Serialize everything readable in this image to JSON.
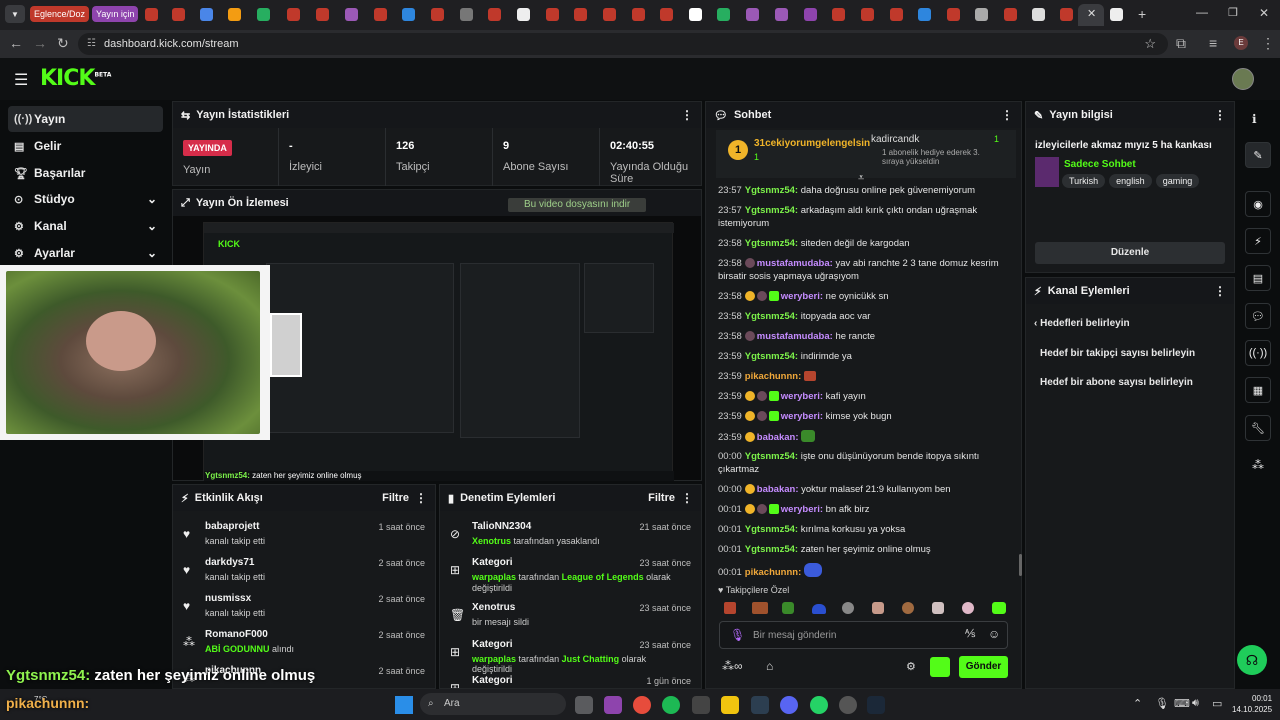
{
  "browser": {
    "pill1": "Eglence/Doz",
    "pill2": "Yayın için",
    "url": "dashboard.kick.com/stream"
  },
  "app": {
    "logo": "KICK",
    "logo_sup": "BETA",
    "brand_color": "#53fc18"
  },
  "sidebar": {
    "items": [
      {
        "label": "Yayın",
        "icon": "stream-icon"
      },
      {
        "label": "Gelir",
        "icon": "revenue-icon"
      },
      {
        "label": "Başarılar",
        "icon": "trophy-icon"
      },
      {
        "label": "Stüdyo",
        "icon": "studio-icon"
      },
      {
        "label": "Kanal",
        "icon": "channel-icon"
      },
      {
        "label": "Ayarlar",
        "icon": "gear-icon"
      }
    ]
  },
  "stats": {
    "title": "Yayın İstatistikleri",
    "live_badge": "YAYINDA",
    "live_label": "Yayın",
    "viewers_value": "-",
    "viewers_label": "İzleyici",
    "followers_value": "126",
    "followers_label": "Takipçi",
    "subs_value": "9",
    "subs_label": "Abone Sayısı",
    "uptime_value": "02:40:55",
    "uptime_label": "Yayında Olduğu Süre"
  },
  "preview": {
    "title": "Yayın Ön İzlemesi",
    "download_hint": "Bu video dosyasını indir",
    "overlay_chat_user": "Ygtsnmz54:",
    "overlay_chat_msg": "zaten her şeyimiz online olmuş",
    "overlay_user2": "pikachunnn:"
  },
  "activity": {
    "title": "Etkinlik Akışı",
    "filter": "Filtre",
    "events": [
      {
        "name": "babaprojett",
        "sub": "kanalı takip etti",
        "time": "1 saat önce"
      },
      {
        "name": "darkdys71",
        "sub": "kanalı takip etti",
        "time": "2 saat önce"
      },
      {
        "name": "nusmissx",
        "sub": "kanalı takip etti",
        "time": "2 saat önce"
      },
      {
        "name": "RomanoF000",
        "sub": "ABİ GODUNNU",
        "sub2": "alındı",
        "time": "2 saat önce"
      },
      {
        "name": "pikachunnn",
        "sub": "",
        "time": "2 saat önce"
      }
    ]
  },
  "moderation": {
    "title": "Denetim Eylemleri",
    "filter": "Filtre",
    "events": [
      {
        "name": "TalioNN2304",
        "g": "Xenotrus",
        "sub": "tarafından yasaklandı",
        "time": "21 saat önce"
      },
      {
        "name": "Kategori",
        "g": "warpaplas",
        "sub": "tarafından",
        "g2": "League of Legends",
        "sub2": "olarak değiştirildi",
        "time": "23 saat önce"
      },
      {
        "name": "Xenotrus",
        "sub": "bir mesajı sildi",
        "time": "23 saat önce"
      },
      {
        "name": "Kategori",
        "g": "warpaplas",
        "sub": "tarafından",
        "g2": "Just Chatting",
        "sub2": "olarak değiştirildi",
        "time": "23 saat önce"
      },
      {
        "name": "Kategori",
        "sub": "",
        "time": "1 gün önce"
      }
    ]
  },
  "chat": {
    "title": "Sohbet",
    "top_user": "31cekiyorumgelengelsin",
    "top_count": "1",
    "gift_user": "kadircandk",
    "gift_count": "1",
    "gift_text": "1 abonelik hediye ederek 3. sıraya yükseldin",
    "messages": [
      {
        "time": "23:57",
        "user": "Ygtsnmz54:",
        "text": "daha doğrusu online pek güvenemiyorum",
        "c": "g"
      },
      {
        "time": "23:57",
        "user": "Ygtsnmz54:",
        "text": "arkadaşım aldı kırık çıktı ondan uğraşmak istemiyorum",
        "c": "g"
      },
      {
        "time": "23:58",
        "user": "Ygtsnmz54:",
        "text": "siteden değil de kargodan",
        "c": "g"
      },
      {
        "time": "23:58",
        "user": "mustafamudaba:",
        "text": "yav abi ranchte 2 3 tane domuz kesrim birsatir sosis yapmaya uğraşıyom",
        "c": "p"
      },
      {
        "time": "23:58",
        "user": "weryberi:",
        "text": "ne oynicükk sn",
        "c": "p"
      },
      {
        "time": "23:58",
        "user": "Ygtsnmz54:",
        "text": "itopyada aoc var",
        "c": "g"
      },
      {
        "time": "23:58",
        "user": "mustafamudaba:",
        "text": "he rancte",
        "c": "p"
      },
      {
        "time": "23:59",
        "user": "Ygtsnmz54:",
        "text": "indirimde ya",
        "c": "g"
      },
      {
        "time": "23:59",
        "user": "pikachunnn:",
        "text": "",
        "c": "o"
      },
      {
        "time": "23:59",
        "user": "weryberi:",
        "text": "kafi yayın",
        "c": "p"
      },
      {
        "time": "23:59",
        "user": "weryberi:",
        "text": "kimse yok bugn",
        "c": "p"
      },
      {
        "time": "23:59",
        "user": "babakan:",
        "text": "",
        "c": "p"
      },
      {
        "time": "00:00",
        "user": "Ygtsnmz54:",
        "text": "işte onu düşünüyorum bende itopya sıkıntı çıkartmaz",
        "c": "g"
      },
      {
        "time": "00:00",
        "user": "babakan:",
        "text": "yoktur malasef 21:9 kullanıyom ben",
        "c": "p"
      },
      {
        "time": "00:01",
        "user": "weryberi:",
        "text": "bn afk birz",
        "c": "p"
      },
      {
        "time": "00:01",
        "user": "Ygtsnmz54:",
        "text": "kırılma korkusu ya yoksa",
        "c": "g"
      },
      {
        "time": "00:01",
        "user": "Ygtsnmz54:",
        "text": "zaten her şeyimiz online olmuş",
        "c": "g"
      },
      {
        "time": "00:01",
        "user": "pikachunnn:",
        "text": "",
        "c": "o"
      }
    ],
    "followers_only": "Takipçilere Özel",
    "placeholder": "Bir mesaj gönderin",
    "send": "Gönder"
  },
  "stream_info": {
    "title": "Yayın bilgisi",
    "stream_title": "izleyicilerle akmaz mıyız 5 ha kankası",
    "category": "Sadece Sohbet",
    "tags": [
      "Turkish",
      "english",
      "gaming"
    ],
    "edit": "Düzenle"
  },
  "channel_actions": {
    "title": "Kanal Eylemleri",
    "back": "Hedefleri belirleyin",
    "goal1": "Hedef bir takipçi sayısı belirleyin",
    "goal2": "Hedef bir abone sayısı belirleyin"
  },
  "taskbar": {
    "search": "Ara",
    "weather_temp": "7°C",
    "time": "00:01",
    "date": "14.10.2025"
  }
}
